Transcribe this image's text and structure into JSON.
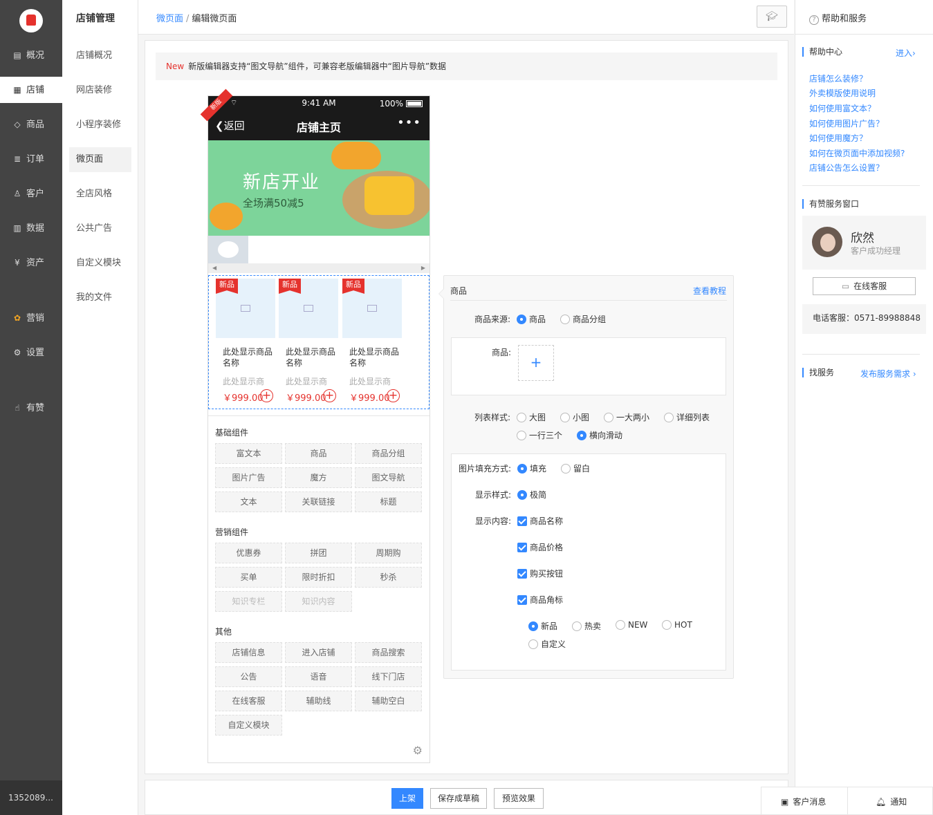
{
  "nav": {
    "user": "1352089...",
    "items": [
      {
        "label": "概况",
        "icon": "chat-icon"
      },
      {
        "label": "店铺",
        "icon": "store-icon"
      },
      {
        "label": "商品",
        "icon": "tag-icon"
      },
      {
        "label": "订单",
        "icon": "list-icon"
      },
      {
        "label": "客户",
        "icon": "user-icon"
      },
      {
        "label": "数据",
        "icon": "bar-chart-icon"
      },
      {
        "label": "资产",
        "icon": "yen-icon"
      },
      {
        "label": "营销",
        "icon": "apps-icon"
      },
      {
        "label": "设置",
        "icon": "gear-icon"
      },
      {
        "label": "有赞",
        "icon": "thumb-up-icon"
      }
    ]
  },
  "subnav": {
    "title": "店铺管理",
    "items": [
      "店铺概况",
      "网店装修",
      "小程序装修",
      "微页面",
      "全店风格",
      "公共广告",
      "自定义模块",
      "我的文件"
    ]
  },
  "breadcrumb": {
    "parent": "微页面",
    "separator": "/",
    "current": "编辑微页面"
  },
  "notice": {
    "new": "New",
    "text": "新版编辑器支持“图文导航”组件，可兼容老版编辑器中“图片导航”数据"
  },
  "phone": {
    "ribbon": "新版",
    "time": "9:41 AM",
    "battery": "100%",
    "back": "返回",
    "title": "店铺主页",
    "more": "•••",
    "banner_title": "新店开业",
    "banner_subtitle": "全场满50减5",
    "goods": [
      {
        "tag": "新品",
        "name": "此处显示商品名称",
        "sub": "此处显示商",
        "price": "￥999.00"
      },
      {
        "tag": "新品",
        "name": "此处显示商品名称",
        "sub": "此处显示商",
        "price": "￥999.00"
      },
      {
        "tag": "新品",
        "name": "此处显示商品名称",
        "sub": "此处显示商",
        "price": "￥999.00"
      }
    ]
  },
  "components": {
    "basic": {
      "title": "基础组件",
      "items": [
        "富文本",
        "商品",
        "商品分组",
        "图片广告",
        "魔方",
        "图文导航",
        "文本",
        "关联链接",
        "标题"
      ]
    },
    "marketing": {
      "title": "营销组件",
      "items": [
        "优惠券",
        "拼团",
        "周期购",
        "买单",
        "限时折扣",
        "秒杀",
        "知识专栏",
        "知识内容"
      ]
    },
    "other": {
      "title": "其他",
      "items": [
        "店铺信息",
        "进入店铺",
        "商品搜索",
        "公告",
        "语音",
        "线下门店",
        "在线客服",
        "辅助线",
        "辅助空白",
        "自定义模块"
      ]
    }
  },
  "editor": {
    "title": "商品",
    "tutorial": "查看教程",
    "source_label": "商品来源:",
    "source_options": [
      "商品",
      "商品分组"
    ],
    "goods_label": "商品:",
    "add": "+",
    "list_label": "列表样式:",
    "list_options": [
      "大图",
      "小图",
      "一大两小",
      "详细列表",
      "一行三个",
      "横向滑动"
    ],
    "fill_label": "图片填充方式:",
    "fill_options": [
      "填充",
      "留白"
    ],
    "display_style_label": "显示样式:",
    "display_style_options": [
      "极简"
    ],
    "display_content_label": "显示内容:",
    "display_content": [
      "商品名称",
      "商品价格",
      "购买按钮",
      "商品角标"
    ],
    "badge_options": [
      "新品",
      "热卖",
      "NEW",
      "HOT",
      "自定义"
    ]
  },
  "actions": {
    "publish": "上架",
    "save_draft": "保存成草稿",
    "preview": "预览效果"
  },
  "help": {
    "title": "帮助和服务",
    "help_center": "帮助中心",
    "enter": "进入",
    "links": [
      "店铺怎么装修？",
      "外卖模版使用说明",
      "如何使用富文本？",
      "如何使用图片广告？",
      "如何使用魔方？",
      "如何在微页面中添加视频?",
      "店铺公告怎么设置？"
    ],
    "service_window": "有赞服务窗口",
    "agent_name": "欣然",
    "agent_role": "客户成功经理",
    "online_service": "在线客服",
    "phone": "电话客服：0571-89988848",
    "find_service": "找服务",
    "post_request": "发布服务需求"
  },
  "footer": {
    "messages": "客户消息",
    "notify": "通知"
  },
  "colors": {
    "accent": "#3388ff",
    "danger": "#e5322d",
    "nav_bg": "#444444"
  }
}
